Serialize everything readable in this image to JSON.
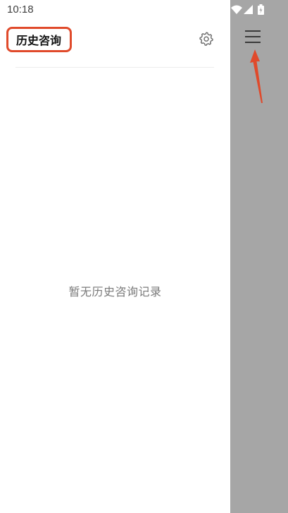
{
  "status_bar": {
    "time": "10:18",
    "icons": [
      "wifi-icon",
      "signal-icon",
      "battery-icon"
    ]
  },
  "drawer": {
    "title": "历史咨询",
    "settings_icon": "gear-icon",
    "empty_state": "暂无历史咨询记录"
  },
  "overlay": {
    "menu_icon": "hamburger-menu-icon"
  },
  "colors": {
    "annotation": "#e04a2b",
    "scrim": "#a6a6a6",
    "drawer_bg": "#ffffff"
  }
}
